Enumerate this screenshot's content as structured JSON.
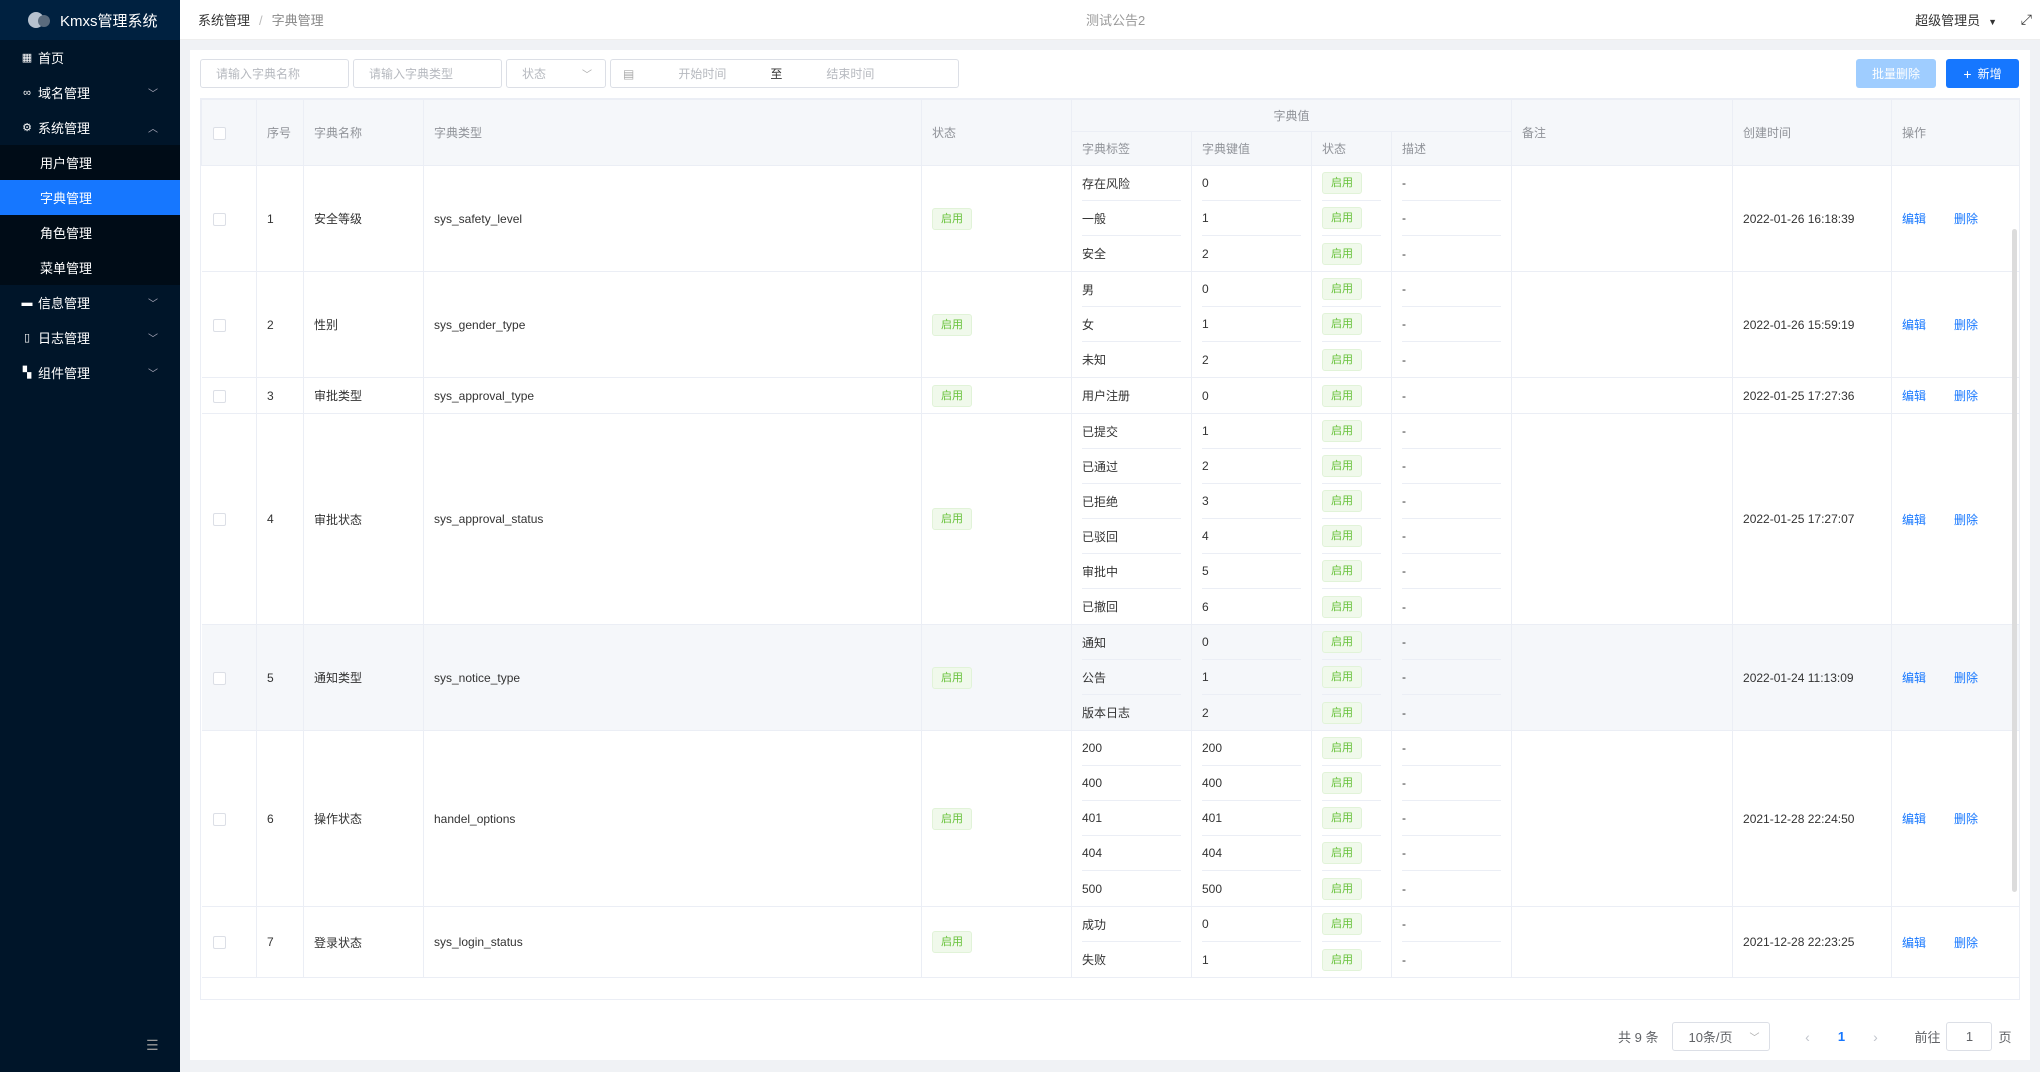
{
  "app": {
    "title": "Kmxs管理系统"
  },
  "sidebar": {
    "items": [
      {
        "label": "首页",
        "icon": "dashboard-icon"
      },
      {
        "label": "域名管理",
        "icon": "link-icon"
      },
      {
        "label": "系统管理",
        "icon": "gear-icon"
      },
      {
        "label": "信息管理",
        "icon": "message-icon"
      },
      {
        "label": "日志管理",
        "icon": "book-icon"
      },
      {
        "label": "组件管理",
        "icon": "grid-icon"
      }
    ],
    "sub_items": [
      {
        "label": "用户管理"
      },
      {
        "label": "字典管理"
      },
      {
        "label": "角色管理"
      },
      {
        "label": "菜单管理"
      }
    ]
  },
  "header": {
    "breadcrumb": [
      "系统管理",
      "字典管理"
    ],
    "notice": "测试公告2",
    "user": "超级管理员"
  },
  "filters": {
    "name_placeholder": "请输入字典名称",
    "type_placeholder": "请输入字典类型",
    "status_placeholder": "状态",
    "start_placeholder": "开始时间",
    "range_sep": "至",
    "end_placeholder": "结束时间"
  },
  "toolbar": {
    "batch_delete": "批量删除",
    "add": "新增"
  },
  "table": {
    "headers": {
      "index": "序号",
      "name": "字典名称",
      "type": "字典类型",
      "status": "状态",
      "dict_value": "字典值",
      "label": "字典标签",
      "key": "字典键值",
      "sub_status": "状态",
      "desc": "描述",
      "remark": "备注",
      "created": "创建时间",
      "ops": "操作"
    },
    "edit_label": "编辑",
    "delete_label": "删除",
    "rows": [
      {
        "index": "1",
        "name": "安全等级",
        "type": "sys_safety_level",
        "status": "启用",
        "created": "2022-01-26 16:18:39",
        "values": [
          {
            "label": "存在风险",
            "key": "0",
            "status": "启用",
            "desc": "-"
          },
          {
            "label": "一般",
            "key": "1",
            "status": "启用",
            "desc": "-"
          },
          {
            "label": "安全",
            "key": "2",
            "status": "启用",
            "desc": "-"
          }
        ]
      },
      {
        "index": "2",
        "name": "性别",
        "type": "sys_gender_type",
        "status": "启用",
        "created": "2022-01-26 15:59:19",
        "values": [
          {
            "label": "男",
            "key": "0",
            "status": "启用",
            "desc": "-"
          },
          {
            "label": "女",
            "key": "1",
            "status": "启用",
            "desc": "-"
          },
          {
            "label": "未知",
            "key": "2",
            "status": "启用",
            "desc": "-"
          }
        ]
      },
      {
        "index": "3",
        "name": "审批类型",
        "type": "sys_approval_type",
        "status": "启用",
        "created": "2022-01-25 17:27:36",
        "values": [
          {
            "label": "用户注册",
            "key": "0",
            "status": "启用",
            "desc": "-"
          }
        ]
      },
      {
        "index": "4",
        "name": "审批状态",
        "type": "sys_approval_status",
        "status": "启用",
        "created": "2022-01-25 17:27:07",
        "values": [
          {
            "label": "已提交",
            "key": "1",
            "status": "启用",
            "desc": "-"
          },
          {
            "label": "已通过",
            "key": "2",
            "status": "启用",
            "desc": "-"
          },
          {
            "label": "已拒绝",
            "key": "3",
            "status": "启用",
            "desc": "-"
          },
          {
            "label": "已驳回",
            "key": "4",
            "status": "启用",
            "desc": "-"
          },
          {
            "label": "审批中",
            "key": "5",
            "status": "启用",
            "desc": "-"
          },
          {
            "label": "已撤回",
            "key": "6",
            "status": "启用",
            "desc": "-"
          }
        ]
      },
      {
        "index": "5",
        "name": "通知类型",
        "type": "sys_notice_type",
        "status": "启用",
        "created": "2022-01-24 11:13:09",
        "values": [
          {
            "label": "通知",
            "key": "0",
            "status": "启用",
            "desc": "-"
          },
          {
            "label": "公告",
            "key": "1",
            "status": "启用",
            "desc": "-"
          },
          {
            "label": "版本日志",
            "key": "2",
            "status": "启用",
            "desc": "-"
          }
        ]
      },
      {
        "index": "6",
        "name": "操作状态",
        "type": "handel_options",
        "status": "启用",
        "created": "2021-12-28 22:24:50",
        "values": [
          {
            "label": "200",
            "key": "200",
            "status": "启用",
            "desc": "-"
          },
          {
            "label": "400",
            "key": "400",
            "status": "启用",
            "desc": "-"
          },
          {
            "label": "401",
            "key": "401",
            "status": "启用",
            "desc": "-"
          },
          {
            "label": "404",
            "key": "404",
            "status": "启用",
            "desc": "-"
          },
          {
            "label": "500",
            "key": "500",
            "status": "启用",
            "desc": "-"
          }
        ]
      },
      {
        "index": "7",
        "name": "登录状态",
        "type": "sys_login_status",
        "status": "启用",
        "created": "2021-12-28 22:23:25",
        "values": [
          {
            "label": "成功",
            "key": "0",
            "status": "启用",
            "desc": "-"
          },
          {
            "label": "失败",
            "key": "1",
            "status": "启用",
            "desc": "-"
          }
        ]
      }
    ]
  },
  "pagination": {
    "total": "共 9 条",
    "page_size": "10条/页",
    "current": "1",
    "goto_label": "前往",
    "goto_value": "1",
    "page_suffix": "页"
  }
}
